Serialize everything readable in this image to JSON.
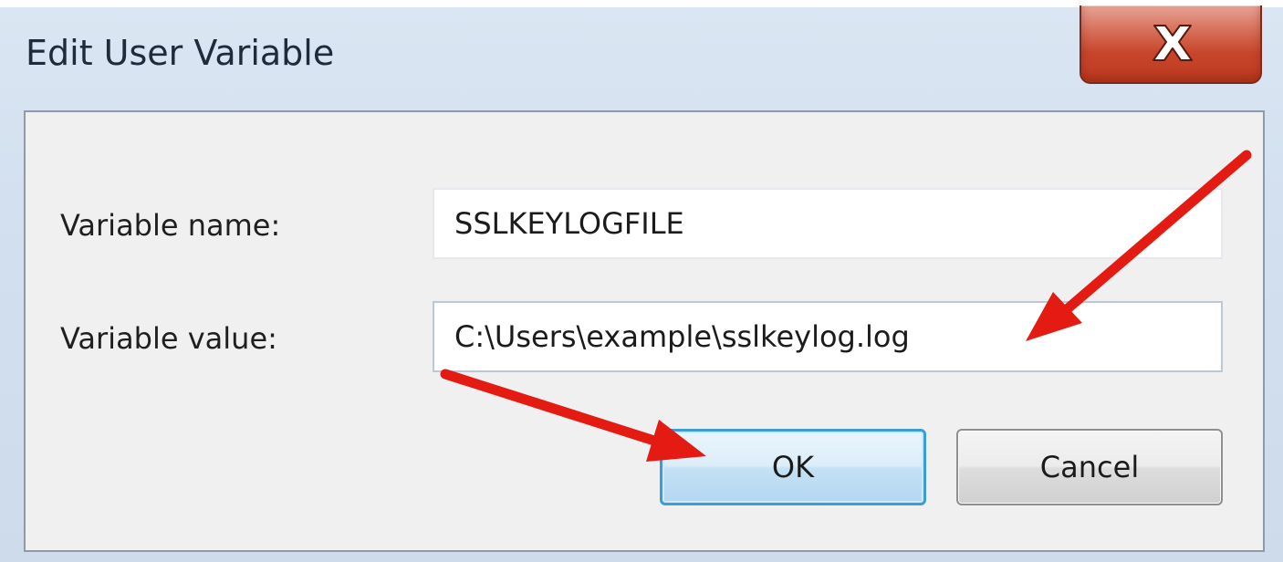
{
  "dialog": {
    "title": "Edit User Variable",
    "close_icon": "close-x-icon"
  },
  "fields": {
    "name_label": "Variable name:",
    "name_value": "SSLKEYLOGFILE",
    "value_label": "Variable value:",
    "value_value": "C:\\Users\\example\\sslkeylog.log"
  },
  "buttons": {
    "ok_label": "OK",
    "cancel_label": "Cancel"
  },
  "colors": {
    "annotation_arrow": "#e31b12",
    "close_button": "#c7452a",
    "ok_button_border": "#3d9bd6"
  }
}
